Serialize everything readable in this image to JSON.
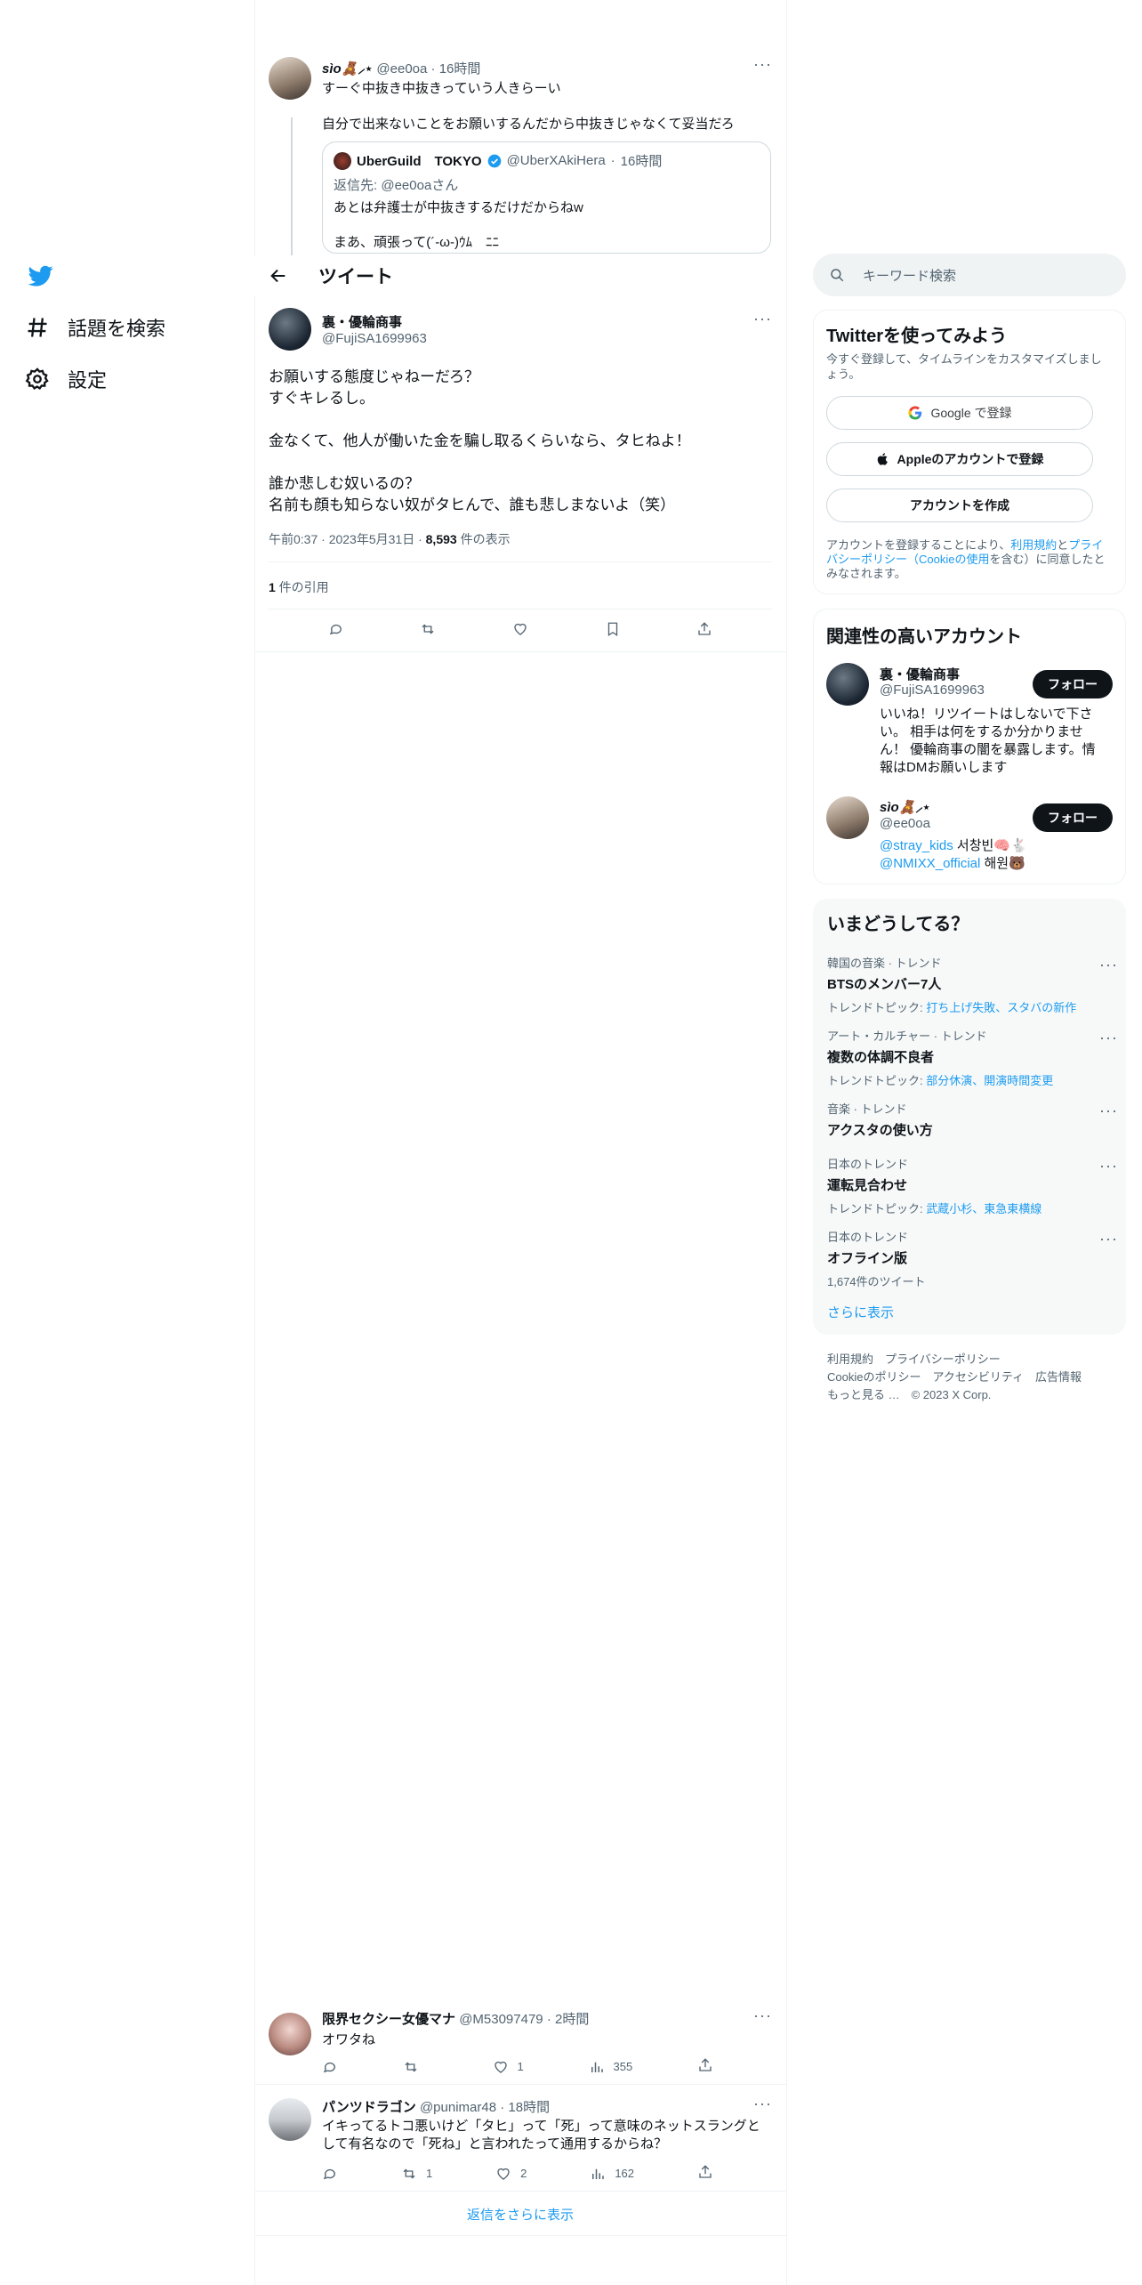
{
  "nav": {
    "items": [
      {
        "label": "話題を検索",
        "icon": "hashtag-icon"
      },
      {
        "label": "設定",
        "icon": "gear-icon"
      }
    ]
  },
  "thread": {
    "parent": {
      "display_name": "sìo🧸⸝⋆",
      "handle": "@ee0oa",
      "time": "16時間",
      "text1": "すーぐ中抜き中抜きっていう人きらーい",
      "text2": "自分で出来ないことをお願いするんだから中抜きじゃなくて妥当だろ",
      "quote": {
        "name": "UberGuild　TOKYO",
        "handle": "@UberXAkiHera",
        "time": "16時間",
        "reply_to_prefix": "返信先: ",
        "reply_to": "@ee0oaさん",
        "line1": "あとは弁護士が中抜きするだけだからねw",
        "line2": "まあ、頑張って(´-ω-)ｳﾑ　ﾆﾆ"
      }
    },
    "header_title": "ツイート",
    "main": {
      "display_name": "裏・優輪商事",
      "handle": "@FujiSA1699963",
      "lines": [
        "お願いする態度じゃねーだろ？",
        "すぐキレるし。",
        "",
        "金なくて、他人が働いた金を騙し取るくらいなら、タヒねよ！",
        "",
        "誰か悲しむ奴いるの？",
        "名前も顔も知らない奴がタヒんで、誰も悲しまないよ（笑）"
      ],
      "timestamp": "午前0:37 · 2023年5月31日 · ",
      "views_count": "8,593",
      "views_label": " 件の表示",
      "quotes_count": "1",
      "quotes_label": " 件の引用"
    },
    "replies": [
      {
        "display_name": "限界セクシー女優マナ",
        "handle": "@M53097479",
        "time": "2時間",
        "text": "オワタね",
        "retweets": "",
        "likes": "1",
        "views": "355"
      },
      {
        "display_name": "パンツドラゴン",
        "handle": "@punimar48",
        "time": "18時間",
        "text": "イキってるトコ悪いけど「タヒ」って「死」って意味のネットスラングとして有名なので「死ね」と言われたって通用するからね？",
        "retweets": "1",
        "likes": "2",
        "views": "162"
      }
    ],
    "show_more": "返信をさらに表示"
  },
  "search": {
    "placeholder": "キーワード検索"
  },
  "signup": {
    "title": "Twitterを使ってみよう",
    "subtitle": "今すぐ登録して、タイムラインをカスタマイズしましょう。",
    "google": "Google で登録",
    "apple": "Appleのアカウントで登録",
    "create": "アカウントを作成",
    "legal_a": "アカウントを登録することにより、",
    "legal_terms": "利用規約",
    "legal_b": "と",
    "legal_privacy": "プライバシーポリシー（Cookieの使用",
    "legal_c": "を含む）に同意したとみなされます。"
  },
  "related": {
    "title": "関連性の高いアカウント",
    "accounts": [
      {
        "name": "裏・優輪商事",
        "handle": "@FujiSA1699963",
        "bio": "いいね！リツイートはしないで下さい。 相手は何をするか分かりません！ 優輪商事の闇を暴露します。情報はDMお願いします",
        "follow": "フォロー"
      },
      {
        "name": "sìo🧸⸝⋆",
        "handle": "@ee0oa",
        "bio_link1": "@stray_kids",
        "bio_text1": " 서창빈🧠🐇",
        "bio_link2": "@NMIXX_official",
        "bio_text2": " 해원🐻",
        "follow": "フォロー"
      }
    ]
  },
  "trends": {
    "title": "いまどうしてる？",
    "items": [
      {
        "context": "韓国の音楽 · トレンド",
        "name": "BTSのメンバー7人",
        "topics_label": "トレンドトピック: ",
        "topics": "打ち上げ失敗、スタバの新作"
      },
      {
        "context": "アート・カルチャー · トレンド",
        "name": "複数の体調不良者",
        "topics_label": "トレンドトピック: ",
        "topics": "部分休演、開演時間変更"
      },
      {
        "context": "音楽 · トレンド",
        "name": "アクスタの使い方",
        "topics_label": "",
        "topics": ""
      },
      {
        "context": "日本のトレンド",
        "name": "運転見合わせ",
        "topics_label": "トレンドトピック: ",
        "topics": "武蔵小杉、東急東横線"
      },
      {
        "context": "日本のトレンド",
        "name": "オフライン版",
        "topics_label": "1,674件のツイート",
        "topics": ""
      }
    ],
    "show_more": "さらに表示"
  },
  "footer": {
    "line1": "利用規約　プライバシーポリシー",
    "line2": "Cookieのポリシー　アクセシビリティ　広告情報",
    "line3": "もっと見る …　© 2023 X Corp."
  },
  "colors": {
    "accent": "#1d9bf0",
    "text": "#0f1419",
    "muted": "#536471",
    "border": "#eff3f4"
  }
}
